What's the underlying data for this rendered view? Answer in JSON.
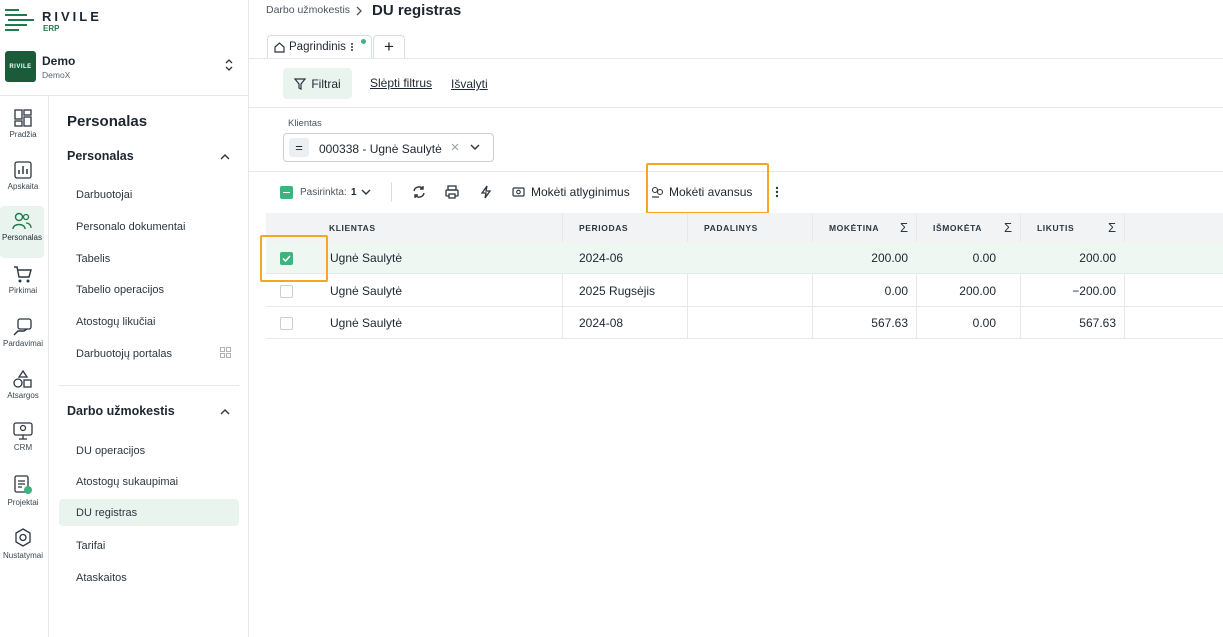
{
  "brand": {
    "name": "RIVILE",
    "sub": "ERP",
    "color": "#1f7a4d"
  },
  "company": {
    "name": "Demo",
    "sub": "DemoX",
    "logo_text": "RIVILE"
  },
  "rail": [
    {
      "label": "Pradžia",
      "icon": "dashboard-icon"
    },
    {
      "label": "Apskaita",
      "icon": "chart-icon"
    },
    {
      "label": "Personalas",
      "icon": "people-icon"
    },
    {
      "label": "Pirkimai",
      "icon": "cart-icon"
    },
    {
      "label": "Pardavimai",
      "icon": "sales-icon"
    },
    {
      "label": "Atsargos",
      "icon": "shapes-icon"
    },
    {
      "label": "CRM",
      "icon": "crm-icon"
    },
    {
      "label": "Projektai",
      "icon": "projects-icon"
    },
    {
      "label": "Nustatymai",
      "icon": "settings-icon"
    }
  ],
  "submenu": {
    "title": "Personalas",
    "group1": "Personalas",
    "group1_items": [
      "Darbuotojai",
      "Personalo dokumentai",
      "Tabelis",
      "Tabelio operacijos",
      "Atostogų likučiai",
      "Darbuotojų portalas"
    ],
    "group2": "Darbo užmokestis",
    "group2_items": [
      "DU operacijos",
      "Atostogų sukaupimai",
      "DU registras",
      "Tarifai",
      "Ataskaitos"
    ]
  },
  "breadcrumb": {
    "parent": "Darbo užmokestis",
    "current": "DU registras"
  },
  "tabs": {
    "main": "Pagrindinis",
    "add": "+"
  },
  "filters": {
    "button": "Filtrai",
    "hide": "Slėpti filtrus",
    "clear": "Išvalyti",
    "field_label": "Klientas",
    "field_value": "000338 - Ugnė Saulytė",
    "op": "="
  },
  "toolbar": {
    "selected_label": "Pasirinkta:",
    "selected_count": "1",
    "pay_salary": "Mokėti atlyginimus",
    "pay_advance": "Mokėti avansus"
  },
  "table": {
    "columns": [
      "KLIENTAS",
      "PERIODAS",
      "PADALINYS",
      "MOKĖTINA",
      "IŠMOKĖTA",
      "LIKUTIS"
    ],
    "rows": [
      {
        "client": "Ugnė Saulytė",
        "period": "2024-06",
        "unit": "",
        "payable": "200.00",
        "paid": "0.00",
        "balance": "200.00",
        "checked": true
      },
      {
        "client": "Ugnė Saulytė",
        "period": "2025 Rugsėjis",
        "unit": "",
        "payable": "0.00",
        "paid": "200.00",
        "balance": "−200.00",
        "checked": false
      },
      {
        "client": "Ugnė Saulytė",
        "period": "2024-08",
        "unit": "",
        "payable": "567.63",
        "paid": "0.00",
        "balance": "567.63",
        "checked": false
      }
    ]
  },
  "colors": {
    "accent": "#1f7a4d",
    "highlight": "#f5a623",
    "active_bg": "#eaf4ef"
  }
}
